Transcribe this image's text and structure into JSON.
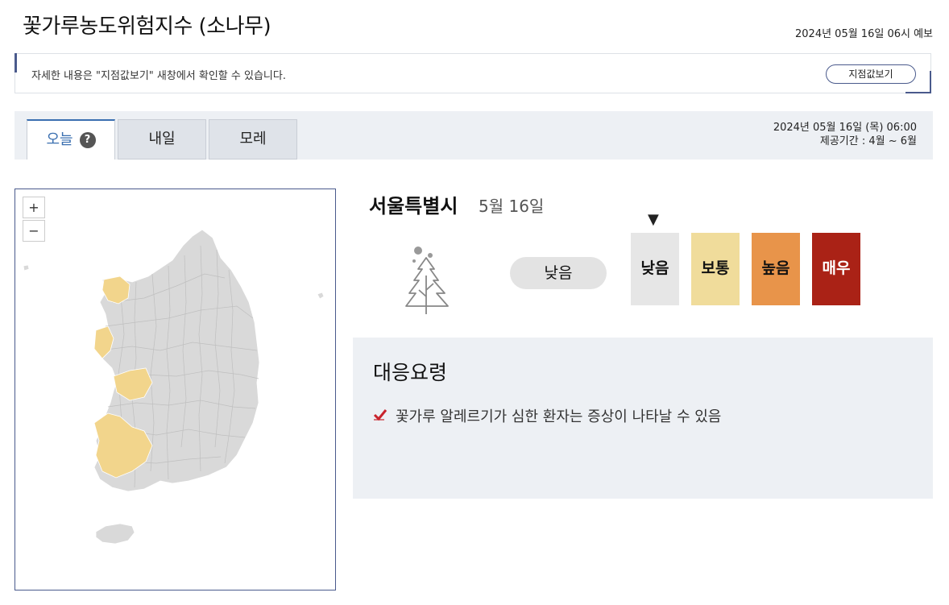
{
  "header": {
    "title": "꽃가루농도위험지수 (소나무)",
    "forecast_label": "2024년 05월 16일 06시 예보"
  },
  "notice": {
    "text": "자세한 내용은 \"지점값보기\" 새창에서 확인할 수 있습니다.",
    "button_label": "지점값보기"
  },
  "tabs": [
    {
      "label": "오늘",
      "active": true
    },
    {
      "label": "내일",
      "active": false
    },
    {
      "label": "모레",
      "active": false
    }
  ],
  "help_icon": "?",
  "date_info": {
    "datetime": "2024년 05월 16일 (목) 06:00",
    "period": "제공기간 : 4월 ~ 6월"
  },
  "map": {
    "zoom_in": "+",
    "zoom_out": "−",
    "colors": {
      "low": "#d9d9d9",
      "moderate": "#f2d58c"
    }
  },
  "detail": {
    "region": "서울특별시",
    "date": "5월 16일",
    "current_level": "낮음",
    "tree_icon": "pine-tree-icon",
    "pointer": "▼"
  },
  "levels": [
    {
      "label": "낮음",
      "bg": "#e6e6e6",
      "fg": "#111111"
    },
    {
      "label": "보통",
      "bg": "#f0dc9b",
      "fg": "#111111"
    },
    {
      "label": "높음",
      "bg": "#e8944a",
      "fg": "#111111"
    },
    {
      "label": "매우",
      "bg": "#aa2216",
      "fg": "#ffffff"
    }
  ],
  "guide": {
    "title": "대응요령",
    "items": [
      "꽃가루 알레르기가 심한 환자는 증상이 나타날 수 있음"
    ]
  }
}
